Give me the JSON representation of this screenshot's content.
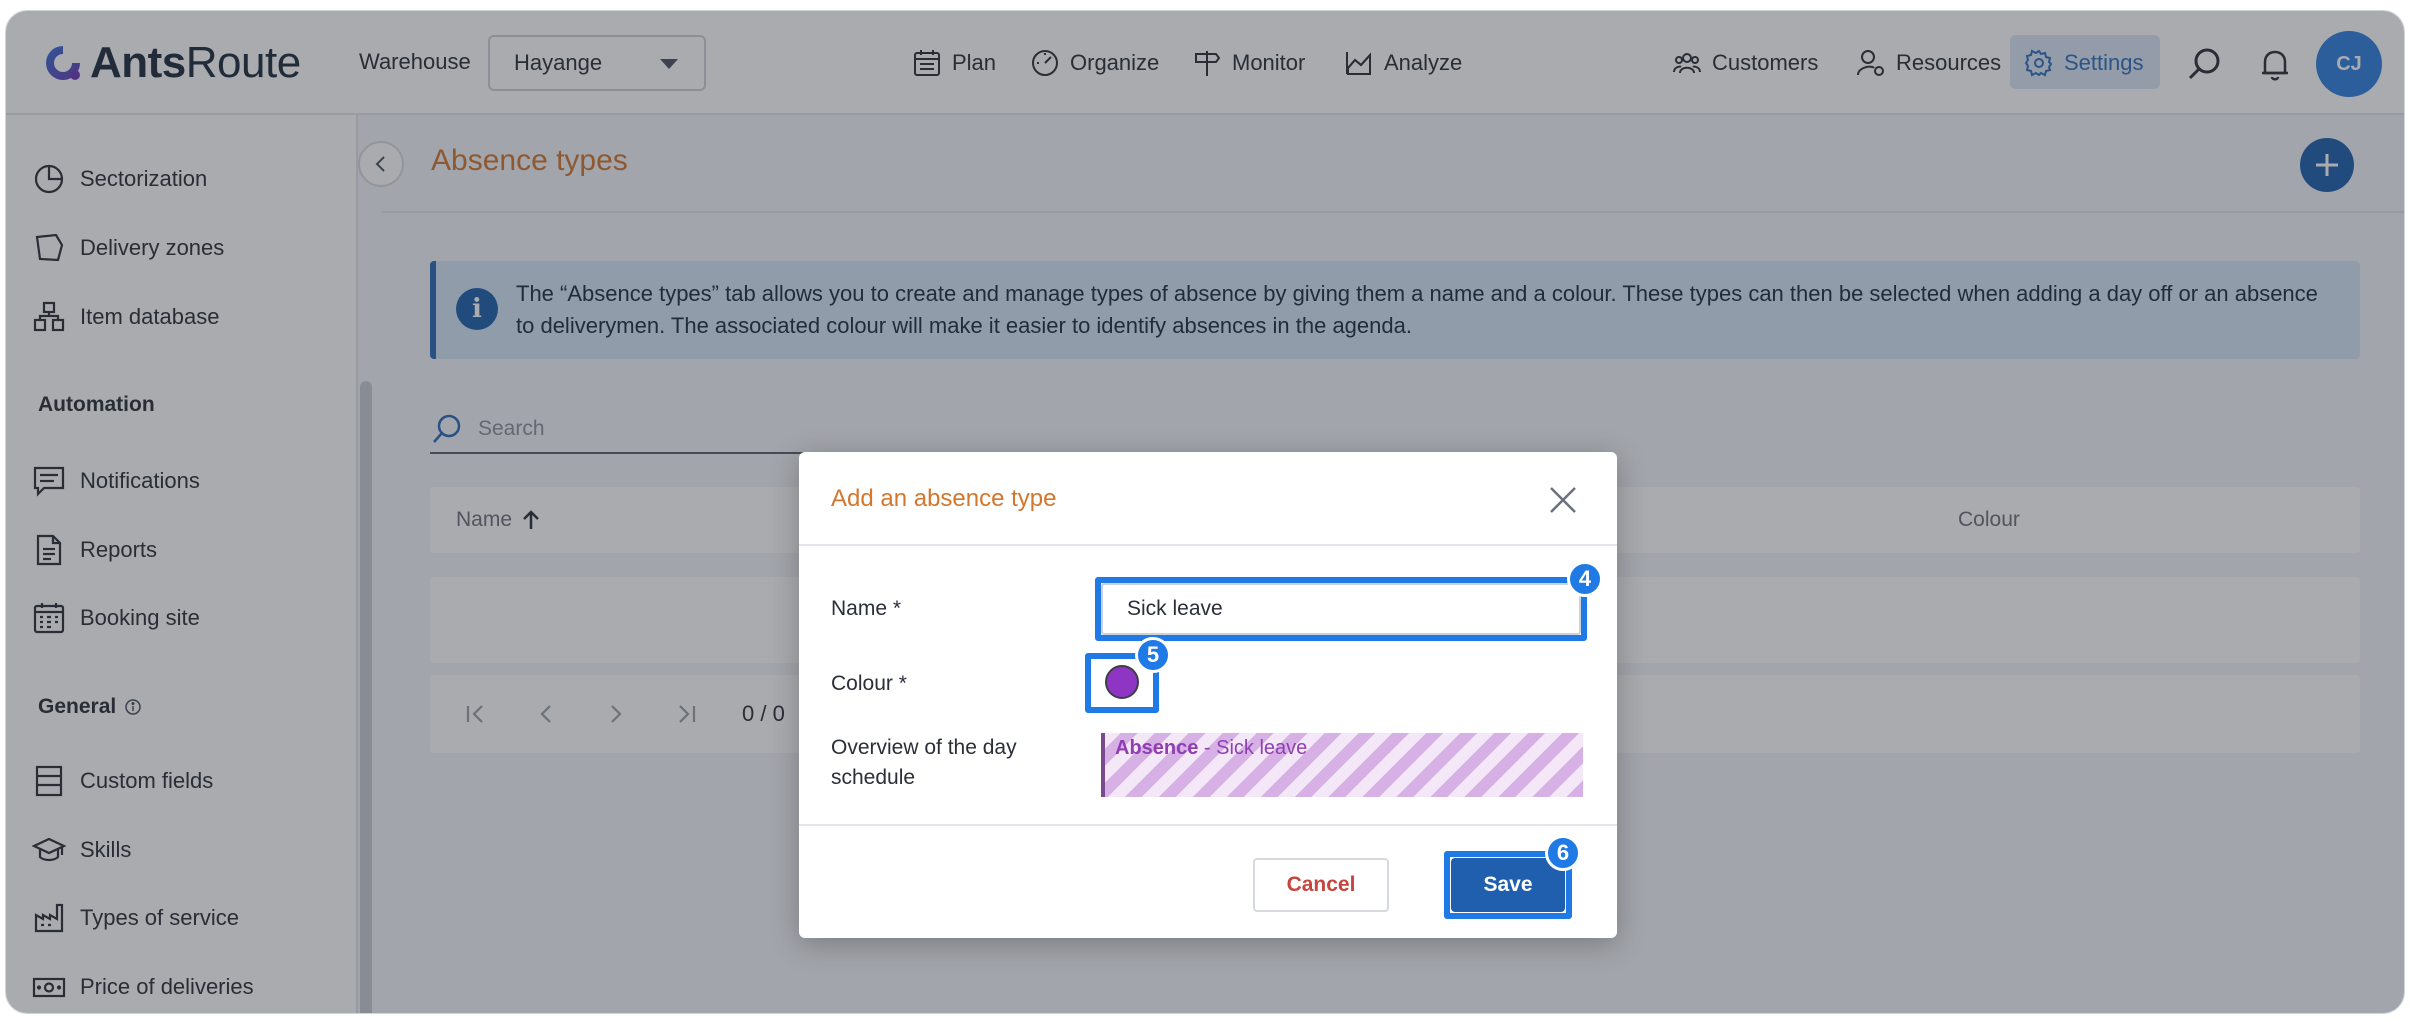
{
  "app": {
    "logo_bold": "Ants",
    "logo_light": "Route",
    "warehouse_label": "Warehouse",
    "warehouse_value": "Hayange",
    "avatar_initials": "CJ",
    "accent_color": "#1f5fae"
  },
  "nav": {
    "plan": "Plan",
    "organize": "Organize",
    "monitor": "Monitor",
    "analyze": "Analyze",
    "customers": "Customers",
    "resources": "Resources",
    "settings": "Settings"
  },
  "sidebar": {
    "items_top": [
      "Sectorization",
      "Delivery zones",
      "Item database"
    ],
    "automation_heading": "Automation",
    "automation_items": [
      "Notifications",
      "Reports",
      "Booking site"
    ],
    "general_heading": "General",
    "general_items": [
      "Custom fields",
      "Skills",
      "Types of service",
      "Price of deliveries"
    ]
  },
  "main": {
    "title": "Absence types",
    "info_text": "The “Absence types” tab allows you to create and manage types of absence by giving them a name and a colour. These types can then be selected when adding a day off or an absence to deliverymen. The associated colour will make it easier to identify absences in the agenda.",
    "search_placeholder": "Search",
    "columns": {
      "name": "Name",
      "colour": "Colour"
    },
    "pagination": "0 / 0"
  },
  "modal": {
    "title": "Add an absence type",
    "name_label": "Name *",
    "name_value": "Sick leave",
    "colour_label": "Colour *",
    "colour_value": "#8e35c4",
    "overview_label": "Overview of the day schedule",
    "preview_bold": "Absence",
    "preview_rest": " - Sick leave",
    "cancel_label": "Cancel",
    "save_label": "Save"
  },
  "annotations": {
    "name_step": "4",
    "colour_step": "5",
    "save_step": "6"
  }
}
